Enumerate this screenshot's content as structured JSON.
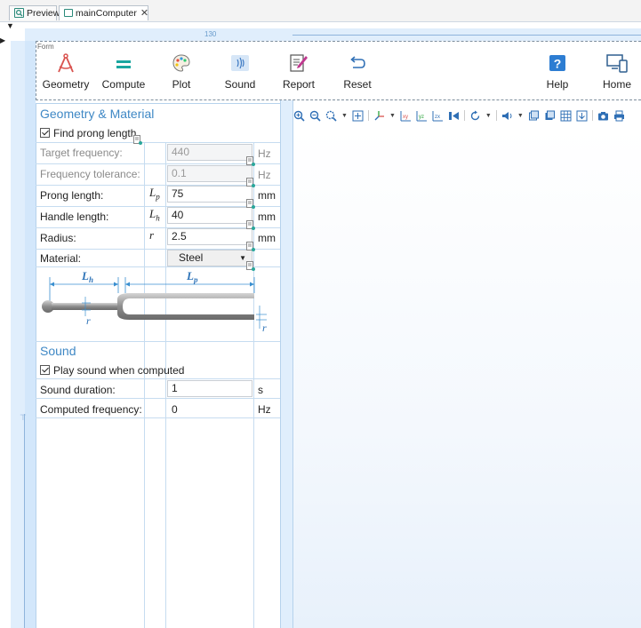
{
  "tabs": [
    {
      "label": "Preview",
      "icon": "preview-icon"
    },
    {
      "label": "mainComputer",
      "icon": "form-icon",
      "close": "✕"
    }
  ],
  "ruler": {
    "mark": "130"
  },
  "form": {
    "label": "Form",
    "ribbon": [
      {
        "label": "Geometry",
        "icon": "geometry-compass-icon"
      },
      {
        "label": "Compute",
        "icon": "compute-equals-icon"
      },
      {
        "label": "Plot",
        "icon": "plot-palette-icon"
      },
      {
        "label": "Sound",
        "icon": "sound-wave-icon"
      },
      {
        "label": "Report",
        "icon": "report-edit-icon"
      },
      {
        "label": "Reset",
        "icon": "reset-undo-icon"
      },
      {
        "label": "Help",
        "icon": "help-question-icon"
      },
      {
        "label": "Home",
        "icon": "home-devices-icon"
      }
    ]
  },
  "geometry_section": {
    "title": "Geometry & Material",
    "find_prong": {
      "label": "Find prong length",
      "checked": true
    },
    "target_frequency": {
      "label": "Target frequency:",
      "value": "440",
      "unit": "Hz"
    },
    "frequency_tolerance": {
      "label": "Frequency tolerance:",
      "value": "0.1",
      "unit": "Hz"
    },
    "prong_length": {
      "label": "Prong length:",
      "sym": "L",
      "sub": "p",
      "value": "75",
      "unit": "mm"
    },
    "handle_length": {
      "label": "Handle length:",
      "sym": "L",
      "sub": "h",
      "value": "40",
      "unit": "mm"
    },
    "radius": {
      "label": "Radius:",
      "sym": "r",
      "value": "2.5",
      "unit": "mm"
    },
    "material": {
      "label": "Material:",
      "value": "Steel"
    },
    "diagram": {
      "lh": "L",
      "lh_sub": "h",
      "lp": "L",
      "lp_sub": "p",
      "r": "r"
    }
  },
  "sound_section": {
    "title": "Sound",
    "play": {
      "label": "Play sound when computed",
      "checked": true
    },
    "duration": {
      "label": "Sound duration:",
      "value": "1",
      "unit": "s"
    },
    "computed_frequency": {
      "label": "Computed frequency:",
      "value": "0",
      "unit": "Hz"
    }
  }
}
